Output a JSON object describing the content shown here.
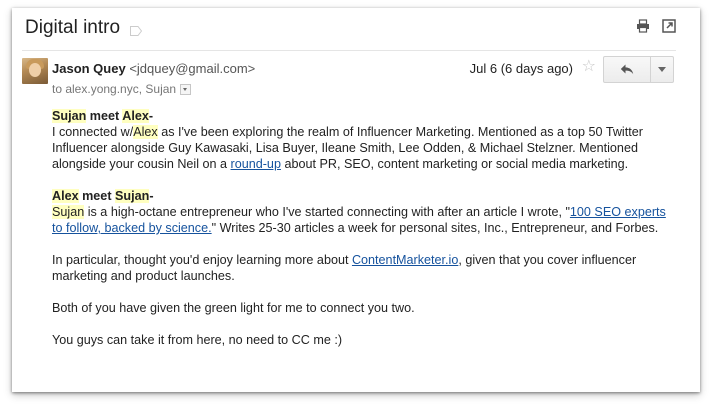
{
  "email": {
    "subject": "Digital intro",
    "sender_name": "Jason Quey",
    "sender_email": "<jdquey@gmail.com>",
    "to_line": "to alex.yong.nyc, Sujan",
    "date": "Jul 6 (6 days ago)"
  },
  "icons": {
    "label": "label-tag-icon",
    "print": "print-icon",
    "popout": "open-in-new-window-icon",
    "star": "star-icon",
    "reply": "reply-arrow-icon",
    "more": "chevron-down-icon"
  },
  "body": {
    "p1": {
      "name1": "Sujan",
      "meet": " meet ",
      "name2": "Alex",
      "dash": "-",
      "t1": "I connected w/",
      "alex": "Alex",
      "t2": " as I've been exploring the realm of Influencer Marketing. Mentioned as a top 50 Twitter Influencer alongside Guy Kawasaki, Lisa Buyer, Ileane Smith, Lee Odden, & Michael Stelzner. Mentioned alongside your cousin Neil on a ",
      "link": "round-up",
      "t3": " about PR, SEO, content marketing or social media marketing."
    },
    "p2": {
      "name1": "Alex",
      "meet": " meet ",
      "name2": "Sujan",
      "dash": "-",
      "sujan": "Sujan",
      "t1": " is a high-octane entrepreneur who I've started connecting with after an article I wrote, \"",
      "link": "100 SEO experts to follow, backed by science.",
      "t2": "\" Writes 25-30 articles a week for personal sites, Inc., Entrepreneur, and Forbes."
    },
    "p3": {
      "t1": "In particular, thought you'd enjoy learning more about ",
      "link": "ContentMarketer.io",
      "t2": ", given that you cover influencer marketing and product launches."
    },
    "p4": "Both of you have given the green light for me to connect you two.",
    "p5": "You guys can take it from here, no need to CC me :)"
  },
  "colors": {
    "highlight": "#ffffc0",
    "link": "#15529d",
    "text": "#222222"
  }
}
